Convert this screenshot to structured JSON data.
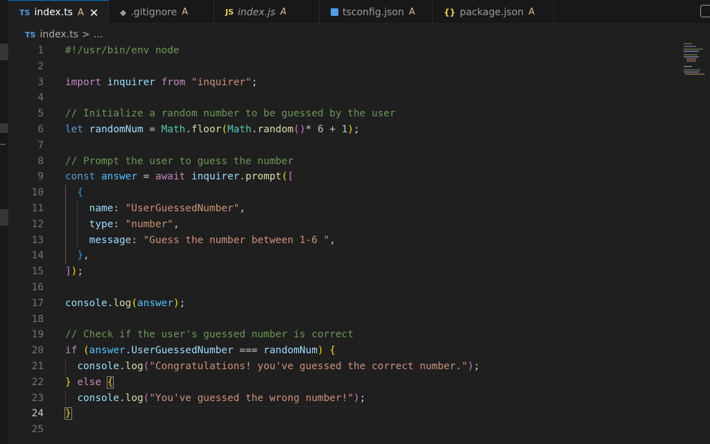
{
  "tabs": [
    {
      "label": "index.ts",
      "icon": "TS",
      "status": "A",
      "active": true,
      "closable": true
    },
    {
      "label": ".gitignore",
      "icon": "git-icon",
      "status": "A"
    },
    {
      "label": "index.js",
      "icon": "JS",
      "status": "A"
    },
    {
      "label": "tsconfig.json",
      "icon": "tsconfig-icon",
      "status": "A"
    },
    {
      "label": "package.json",
      "icon": "{}",
      "status": "A"
    }
  ],
  "breadcrumb": {
    "icon": "TS",
    "file": "index.ts",
    "separator": ">",
    "more": "..."
  },
  "editor": {
    "current_line": 24,
    "lines": [
      [
        [
          "cmt",
          "#!/usr/bin/env node"
        ]
      ],
      [],
      [
        [
          "ctl",
          "import"
        ],
        [
          "pl",
          " "
        ],
        [
          "var",
          "inquirer"
        ],
        [
          "pl",
          " "
        ],
        [
          "ctl",
          "from"
        ],
        [
          "pl",
          " "
        ],
        [
          "str",
          "\"inquirer\""
        ],
        [
          "pl",
          ";"
        ]
      ],
      [],
      [
        [
          "cmt",
          "// Initialize a random number to be guessed by the user"
        ]
      ],
      [
        [
          "kw",
          "let"
        ],
        [
          "pl",
          " "
        ],
        [
          "var",
          "randomNum"
        ],
        [
          "pl",
          " = "
        ],
        [
          "cls",
          "Math"
        ],
        [
          "pl",
          "."
        ],
        [
          "fn",
          "floor"
        ],
        [
          "br1",
          "("
        ],
        [
          "cls",
          "Math"
        ],
        [
          "pl",
          "."
        ],
        [
          "fn",
          "random"
        ],
        [
          "br2",
          "()"
        ],
        [
          "pl",
          "* "
        ],
        [
          "num",
          "6"
        ],
        [
          "pl",
          " + "
        ],
        [
          "num",
          "1"
        ],
        [
          "br1",
          ")"
        ],
        [
          "pl",
          ";"
        ]
      ],
      [],
      [
        [
          "cmt",
          "// Prompt the user to guess the number"
        ]
      ],
      [
        [
          "kw",
          "const"
        ],
        [
          "pl",
          " "
        ],
        [
          "cst",
          "answer"
        ],
        [
          "pl",
          " = "
        ],
        [
          "ctl",
          "await"
        ],
        [
          "pl",
          " "
        ],
        [
          "var",
          "inquirer"
        ],
        [
          "pl",
          "."
        ],
        [
          "fn",
          "prompt"
        ],
        [
          "br1",
          "("
        ],
        [
          "br2",
          "["
        ]
      ],
      [
        [
          "pl",
          "  "
        ],
        [
          "br3",
          "{"
        ]
      ],
      [
        [
          "pl",
          "    "
        ],
        [
          "var",
          "name"
        ],
        [
          "pl",
          ": "
        ],
        [
          "str",
          "\"UserGuessedNumber\""
        ],
        [
          "pl",
          ","
        ]
      ],
      [
        [
          "pl",
          "    "
        ],
        [
          "var",
          "type"
        ],
        [
          "pl",
          ": "
        ],
        [
          "str",
          "\"number\""
        ],
        [
          "pl",
          ","
        ]
      ],
      [
        [
          "pl",
          "    "
        ],
        [
          "var",
          "message"
        ],
        [
          "pl",
          ": "
        ],
        [
          "str",
          "\"Guess the number between 1-6 \""
        ],
        [
          "pl",
          ","
        ]
      ],
      [
        [
          "pl",
          "  "
        ],
        [
          "br3",
          "}"
        ],
        [
          "pl",
          ","
        ]
      ],
      [
        [
          "br2",
          "]"
        ],
        [
          "br1",
          ")"
        ],
        [
          "pl",
          ";"
        ]
      ],
      [],
      [
        [
          "var",
          "console"
        ],
        [
          "pl",
          "."
        ],
        [
          "fn",
          "log"
        ],
        [
          "br1",
          "("
        ],
        [
          "cst",
          "answer"
        ],
        [
          "br1",
          ")"
        ],
        [
          "pl",
          ";"
        ]
      ],
      [],
      [
        [
          "cmt",
          "// Check if the user's guessed number is correct"
        ]
      ],
      [
        [
          "ctl",
          "if"
        ],
        [
          "pl",
          " "
        ],
        [
          "br1",
          "("
        ],
        [
          "cst",
          "answer"
        ],
        [
          "pl",
          "."
        ],
        [
          "var",
          "UserGuessedNumber"
        ],
        [
          "pl",
          " === "
        ],
        [
          "var",
          "randomNum"
        ],
        [
          "br1",
          ")"
        ],
        [
          "pl",
          " "
        ],
        [
          "br1",
          "{"
        ]
      ],
      [
        [
          "pl",
          "  "
        ],
        [
          "var",
          "console"
        ],
        [
          "pl",
          "."
        ],
        [
          "fn",
          "log"
        ],
        [
          "br2",
          "("
        ],
        [
          "str",
          "\"Congratulations! you've guessed the correct number.\""
        ],
        [
          "br2",
          ")"
        ],
        [
          "pl",
          ";"
        ]
      ],
      [
        [
          "br1",
          "}"
        ],
        [
          "pl",
          " "
        ],
        [
          "ctl",
          "else"
        ],
        [
          "pl",
          " "
        ],
        [
          "br1bm",
          "{"
        ]
      ],
      [
        [
          "pl",
          "  "
        ],
        [
          "var",
          "console"
        ],
        [
          "pl",
          "."
        ],
        [
          "fn",
          "log"
        ],
        [
          "br2",
          "("
        ],
        [
          "str",
          "\"You've guessed the wrong number!\""
        ],
        [
          "br2",
          ")"
        ],
        [
          "pl",
          ";"
        ]
      ],
      [
        [
          "br1bm",
          "}"
        ]
      ],
      []
    ]
  },
  "colors": {
    "accent": "#0078d4",
    "status_added": "#e2c08d",
    "ts_blue": "#4d9ee6",
    "js_yellow": "#e8d44d",
    "background": "#1f1f1f"
  }
}
